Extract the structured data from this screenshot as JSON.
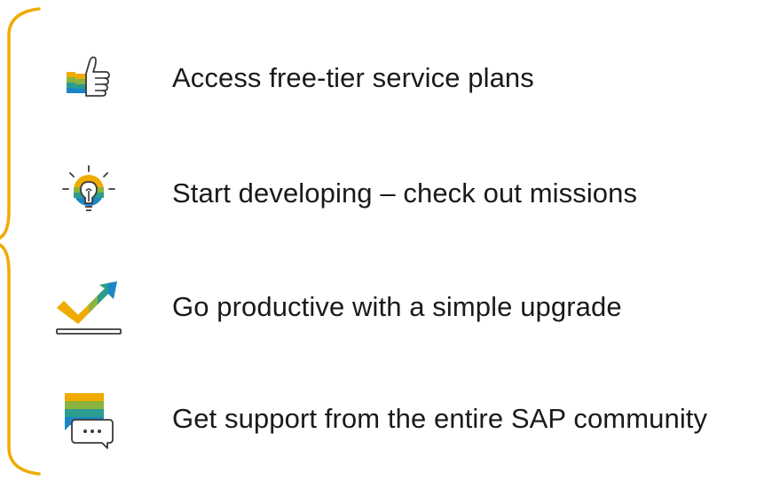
{
  "colors": {
    "brace": "#f0ab00",
    "yellow": "#f0ab00",
    "green": "#8ab33f",
    "teal": "#2a9d8f",
    "blue": "#1b86c7",
    "outline": "#3a3a3a"
  },
  "items": [
    {
      "icon": "thumbs-up-icon",
      "label": "Access free-tier service plans"
    },
    {
      "icon": "lightbulb-icon",
      "label": "Start developing – check out missions"
    },
    {
      "icon": "checkmark-arrow-icon",
      "label": "Go productive with a simple upgrade"
    },
    {
      "icon": "chat-bubble-icon",
      "label": "Get support from the entire SAP community"
    }
  ]
}
